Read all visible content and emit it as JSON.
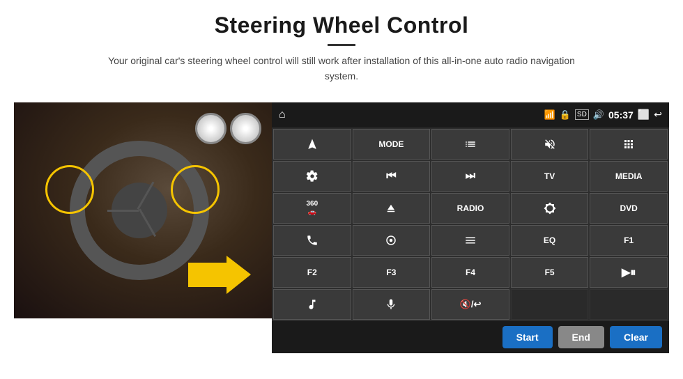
{
  "page": {
    "title": "Steering Wheel Control",
    "divider": true,
    "subtitle": "Your original car's steering wheel control will still work after installation of this all-in-one auto radio navigation system."
  },
  "status_bar": {
    "wifi_icon": "wifi",
    "lock_icon": "lock",
    "sd_icon": "sd",
    "bt_icon": "bluetooth",
    "time": "05:37",
    "screen_icon": "screen",
    "back_icon": "back",
    "home_icon": "home"
  },
  "control_buttons": [
    {
      "id": "nav",
      "type": "icon",
      "icon": "navigate",
      "label": ""
    },
    {
      "id": "mode",
      "type": "text",
      "label": "MODE"
    },
    {
      "id": "list",
      "type": "icon",
      "icon": "list",
      "label": ""
    },
    {
      "id": "mute",
      "type": "icon",
      "icon": "mute",
      "label": ""
    },
    {
      "id": "apps",
      "type": "icon",
      "icon": "apps",
      "label": ""
    },
    {
      "id": "settings",
      "type": "icon",
      "icon": "settings",
      "label": ""
    },
    {
      "id": "prev",
      "type": "icon",
      "icon": "prev",
      "label": ""
    },
    {
      "id": "next",
      "type": "icon",
      "icon": "next",
      "label": ""
    },
    {
      "id": "tv",
      "type": "text",
      "label": "TV"
    },
    {
      "id": "media",
      "type": "text",
      "label": "MEDIA"
    },
    {
      "id": "360",
      "type": "text",
      "label": "360"
    },
    {
      "id": "eject",
      "type": "icon",
      "icon": "eject",
      "label": ""
    },
    {
      "id": "radio",
      "type": "text",
      "label": "RADIO"
    },
    {
      "id": "bright",
      "type": "icon",
      "icon": "brightness",
      "label": ""
    },
    {
      "id": "dvd",
      "type": "text",
      "label": "DVD"
    },
    {
      "id": "phone",
      "type": "icon",
      "icon": "phone",
      "label": ""
    },
    {
      "id": "navi",
      "type": "icon",
      "icon": "navi",
      "label": ""
    },
    {
      "id": "dash",
      "type": "icon",
      "icon": "dash",
      "label": ""
    },
    {
      "id": "eq",
      "type": "text",
      "label": "EQ"
    },
    {
      "id": "f1",
      "type": "text",
      "label": "F1"
    },
    {
      "id": "f2",
      "type": "text",
      "label": "F2"
    },
    {
      "id": "f3",
      "type": "text",
      "label": "F3"
    },
    {
      "id": "f4",
      "type": "text",
      "label": "F4"
    },
    {
      "id": "f5",
      "type": "text",
      "label": "F5"
    },
    {
      "id": "playpause",
      "type": "icon",
      "icon": "playpause",
      "label": ""
    },
    {
      "id": "music",
      "type": "icon",
      "icon": "music",
      "label": ""
    },
    {
      "id": "mic",
      "type": "icon",
      "icon": "mic",
      "label": ""
    },
    {
      "id": "phonecall",
      "type": "icon",
      "icon": "phonecall",
      "label": ""
    },
    {
      "id": "empty1",
      "type": "empty",
      "label": ""
    },
    {
      "id": "empty2",
      "type": "empty",
      "label": ""
    }
  ],
  "action_buttons": {
    "start_label": "Start",
    "end_label": "End",
    "clear_label": "Clear"
  }
}
